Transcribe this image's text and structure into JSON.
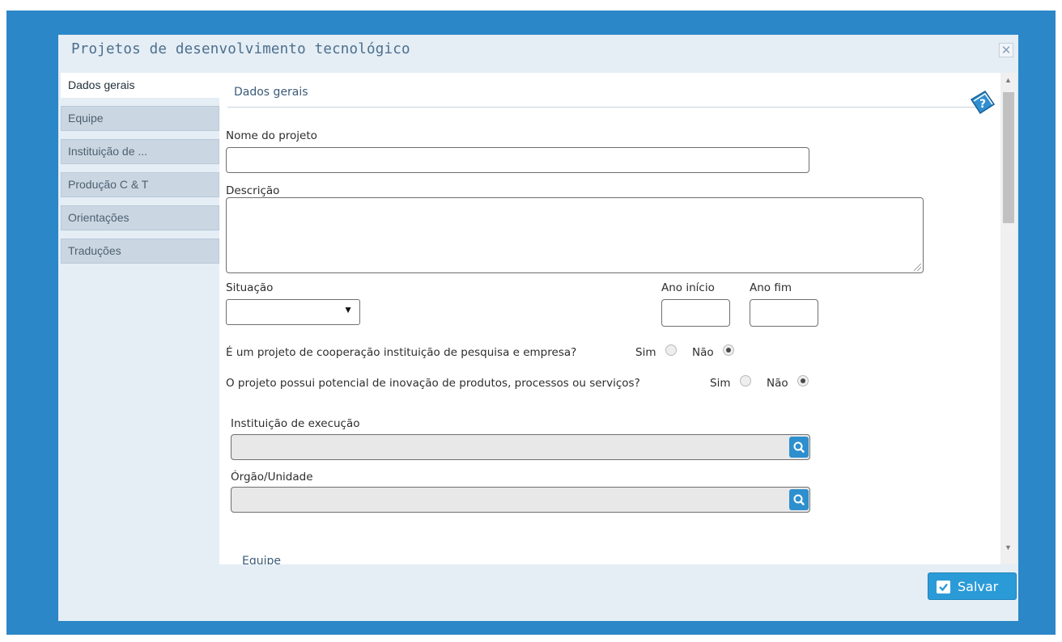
{
  "dialog": {
    "title": "Projetos de desenvolvimento tecnológico",
    "close_icon": "close-icon"
  },
  "tabs": [
    {
      "label": "Dados gerais",
      "active": true
    },
    {
      "label": "Equipe",
      "active": false
    },
    {
      "label": "Instituição de ...",
      "active": false
    },
    {
      "label": "Produção C & T",
      "active": false
    },
    {
      "label": "Orientações",
      "active": false
    },
    {
      "label": "Traduções",
      "active": false
    }
  ],
  "section": {
    "title": "Dados gerais",
    "help_icon": "help-book-icon"
  },
  "form": {
    "nome_label": "Nome do projeto",
    "nome_value": "",
    "descricao_label": "Descrição",
    "descricao_value": "",
    "situacao_label": "Situação",
    "situacao_value": "",
    "ano_inicio_label": "Ano início",
    "ano_inicio_value": "",
    "ano_fim_label": "Ano fim",
    "ano_fim_value": "",
    "q1_text": "É um projeto de cooperação instituição de pesquisa e empresa?",
    "q1_sim": "Sim",
    "q1_nao": "Não",
    "q1_selected": "Não",
    "q2_text": "O projeto possui potencial de inovação de produtos, processos ou serviços?",
    "q2_sim": "Sim",
    "q2_nao": "Não",
    "q2_selected": "Não",
    "instituicao_label": "Instituição de execução",
    "instituicao_value": "",
    "orgao_label": "Órgão/Unidade",
    "orgao_value": "",
    "next_section": "Equipe"
  },
  "footer": {
    "save_label": "Salvar"
  },
  "colors": {
    "background": "#2b87c8",
    "dialog": "#e5edf5",
    "accent_button": "#2b9bd8",
    "title_text": "#4b6f8c"
  }
}
